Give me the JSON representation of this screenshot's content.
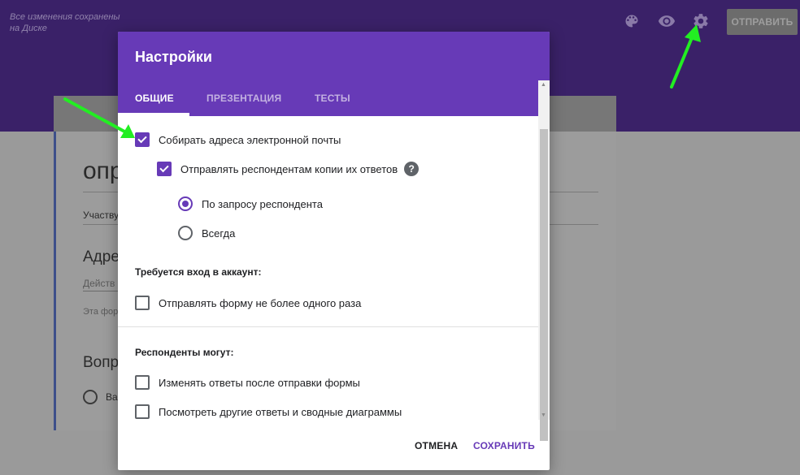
{
  "topbar": {
    "saved_note": "Все изменения сохранены на Диске",
    "send_label": "ОТПРАВИТЬ",
    "icons": [
      "palette-icon",
      "eye-icon",
      "gear-icon"
    ]
  },
  "background_form": {
    "title_fragment": "опр",
    "line1": "Участву",
    "address_fragment": "Адре",
    "action_fragment": "Действ",
    "note_fragment": "Эта фор",
    "question_fragment": "Вопр",
    "option_fragment": "Вар"
  },
  "dialog": {
    "title": "Настройки",
    "tabs": [
      {
        "label": "ОБЩИЕ",
        "active": true
      },
      {
        "label": "ПРЕЗЕНТАЦИЯ",
        "active": false
      },
      {
        "label": "ТЕСТЫ",
        "active": false
      }
    ],
    "collect_emails": {
      "label": "Собирать адреса электронной почты",
      "checked": true
    },
    "send_copies": {
      "label": "Отправлять респондентам копии их ответов",
      "checked": true
    },
    "copy_options": [
      {
        "label": "По запросу респондента",
        "selected": true
      },
      {
        "label": "Всегда",
        "selected": false
      }
    ],
    "login_section": {
      "title": "Требуется вход в аккаунт:",
      "once_only": {
        "label": "Отправлять форму не более одного раза",
        "checked": false
      }
    },
    "respondents_section": {
      "title": "Респонденты могут:",
      "edit_after": {
        "label": "Изменять ответы после отправки формы",
        "checked": false
      },
      "see_summary": {
        "label": "Посмотреть другие ответы и сводные диаграммы",
        "checked": false
      }
    },
    "cancel_label": "ОТМЕНА",
    "save_label": "СОХРАНИТЬ"
  },
  "colors": {
    "accent": "#673ab7",
    "topbar": "#3a2168",
    "annotation_arrow": "#22ee22"
  }
}
